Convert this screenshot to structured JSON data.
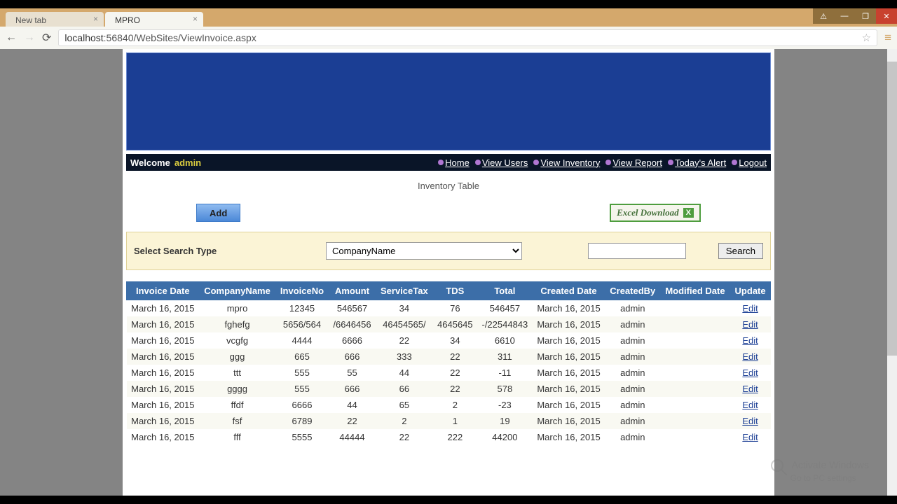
{
  "browser": {
    "tabs": [
      {
        "title": "New tab"
      },
      {
        "title": "MPRO"
      }
    ],
    "url_prefix": "localhost",
    "url_path": ":56840/WebSites/ViewInvoice.aspx"
  },
  "menubar": {
    "welcome": "Welcome",
    "user": "admin",
    "links": [
      "Home",
      "View Users",
      "View Inventory",
      "View Report",
      "Today's Alert",
      "Logout"
    ]
  },
  "page": {
    "title": "Inventory Table",
    "add_label": "Add",
    "excel_label": "Excel Download"
  },
  "search": {
    "label": "Select Search Type",
    "selected": "CompanyName",
    "button": "Search",
    "value": ""
  },
  "table": {
    "headers": [
      "Invoice Date",
      "CompanyName",
      "InvoiceNo",
      "Amount",
      "ServiceTax",
      "TDS",
      "Total",
      "Created Date",
      "CreatedBy",
      "Modified Date",
      "Update"
    ],
    "rows": [
      [
        "March 16, 2015",
        "mpro",
        "12345",
        "546567",
        "34",
        "76",
        "546457",
        "March 16, 2015",
        "admin",
        "",
        "Edit"
      ],
      [
        "March 16, 2015",
        "fghefg",
        "5656/564",
        "/6646456",
        "46454565/",
        "4645645",
        "-/22544843",
        "March 16, 2015",
        "admin",
        "",
        "Edit"
      ],
      [
        "March 16, 2015",
        "vcgfg",
        "4444",
        "6666",
        "22",
        "34",
        "6610",
        "March 16, 2015",
        "admin",
        "",
        "Edit"
      ],
      [
        "March 16, 2015",
        "ggg",
        "665",
        "666",
        "333",
        "22",
        "311",
        "March 16, 2015",
        "admin",
        "",
        "Edit"
      ],
      [
        "March 16, 2015",
        "ttt",
        "555",
        "55",
        "44",
        "22",
        "-11",
        "March 16, 2015",
        "admin",
        "",
        "Edit"
      ],
      [
        "March 16, 2015",
        "gggg",
        "555",
        "666",
        "66",
        "22",
        "578",
        "March 16, 2015",
        "admin",
        "",
        "Edit"
      ],
      [
        "March 16, 2015",
        "ffdf",
        "6666",
        "44",
        "65",
        "2",
        "-23",
        "March 16, 2015",
        "admin",
        "",
        "Edit"
      ],
      [
        "March 16, 2015",
        "fsf",
        "6789",
        "22",
        "2",
        "1",
        "19",
        "March 16, 2015",
        "admin",
        "",
        "Edit"
      ],
      [
        "March 16, 2015",
        "fff",
        "5555",
        "44444",
        "22",
        "222",
        "44200",
        "March 16, 2015",
        "admin",
        "",
        "Edit"
      ]
    ]
  },
  "watermark": {
    "line1": "Activate Windows",
    "line2": "Go to PC settings"
  }
}
